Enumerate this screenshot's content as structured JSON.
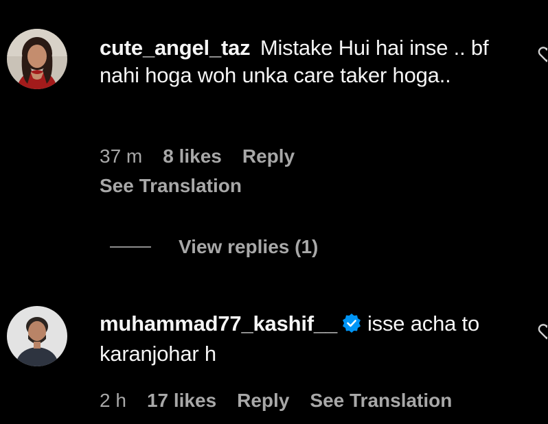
{
  "comments": [
    {
      "username": "cute_angel_taz",
      "text": "Mistake Hui hai inse .. bf nahi hoga woh unka care taker hoga..",
      "time": "37 m",
      "likes": "8 likes",
      "reply_label": "Reply",
      "translate_label": "See Translation",
      "view_replies": "View replies (1)"
    },
    {
      "username": "muhammad77_kashif__",
      "verified": true,
      "text": "isse acha to karanjohar h",
      "time": "2 h",
      "likes": "17 likes",
      "reply_label": "Reply",
      "translate_label": "See Translation"
    }
  ],
  "colors": {
    "background": "#000000",
    "primary_text": "#f5f5f5",
    "secondary_text": "#a8a8a8",
    "verified_badge": "#0095f6"
  },
  "icons": [
    "heart-icon",
    "verified-badge-icon"
  ]
}
